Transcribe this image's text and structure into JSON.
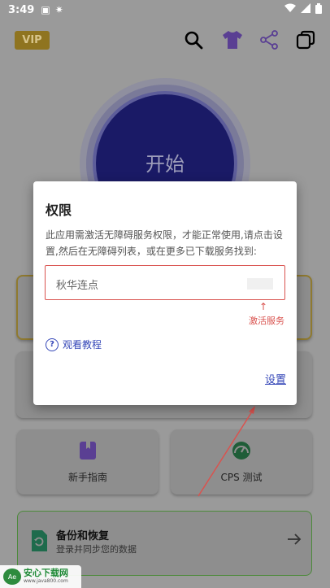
{
  "status_bar": {
    "time": "3:49"
  },
  "topbar": {
    "vip_label": "VIP",
    "icons": [
      "search-icon",
      "shirt-icon",
      "share-icon",
      "copy-icon"
    ]
  },
  "start_button": {
    "label": "开始"
  },
  "tiles": [
    {
      "label": "新手指南",
      "icon": "guide-book-icon"
    },
    {
      "label": "CPS 测试",
      "icon": "speedometer-icon"
    }
  ],
  "backup": {
    "title": "备份和恢复",
    "subtitle": "登录并同步您的数据"
  },
  "dialog": {
    "title": "权限",
    "message": "此应用需激活无障碍服务权限，才能正常使用,请点击设置,然后在无障碍列表，或在更多已下载服务找到:",
    "service_name": "秋华连点",
    "arrow": "↑",
    "activate_label": "激活服务",
    "tutorial_label": "观看教程",
    "settings_label": "设置"
  },
  "watermark": {
    "title": "安心下载网",
    "url": "www.java800.com",
    "logo_text": "Ae"
  },
  "colors": {
    "start_button": "#1a1a66",
    "vip": "#8f7420",
    "link": "#3547b8",
    "warning": "#d9534f",
    "accent_purple": "#6a4bb5"
  }
}
